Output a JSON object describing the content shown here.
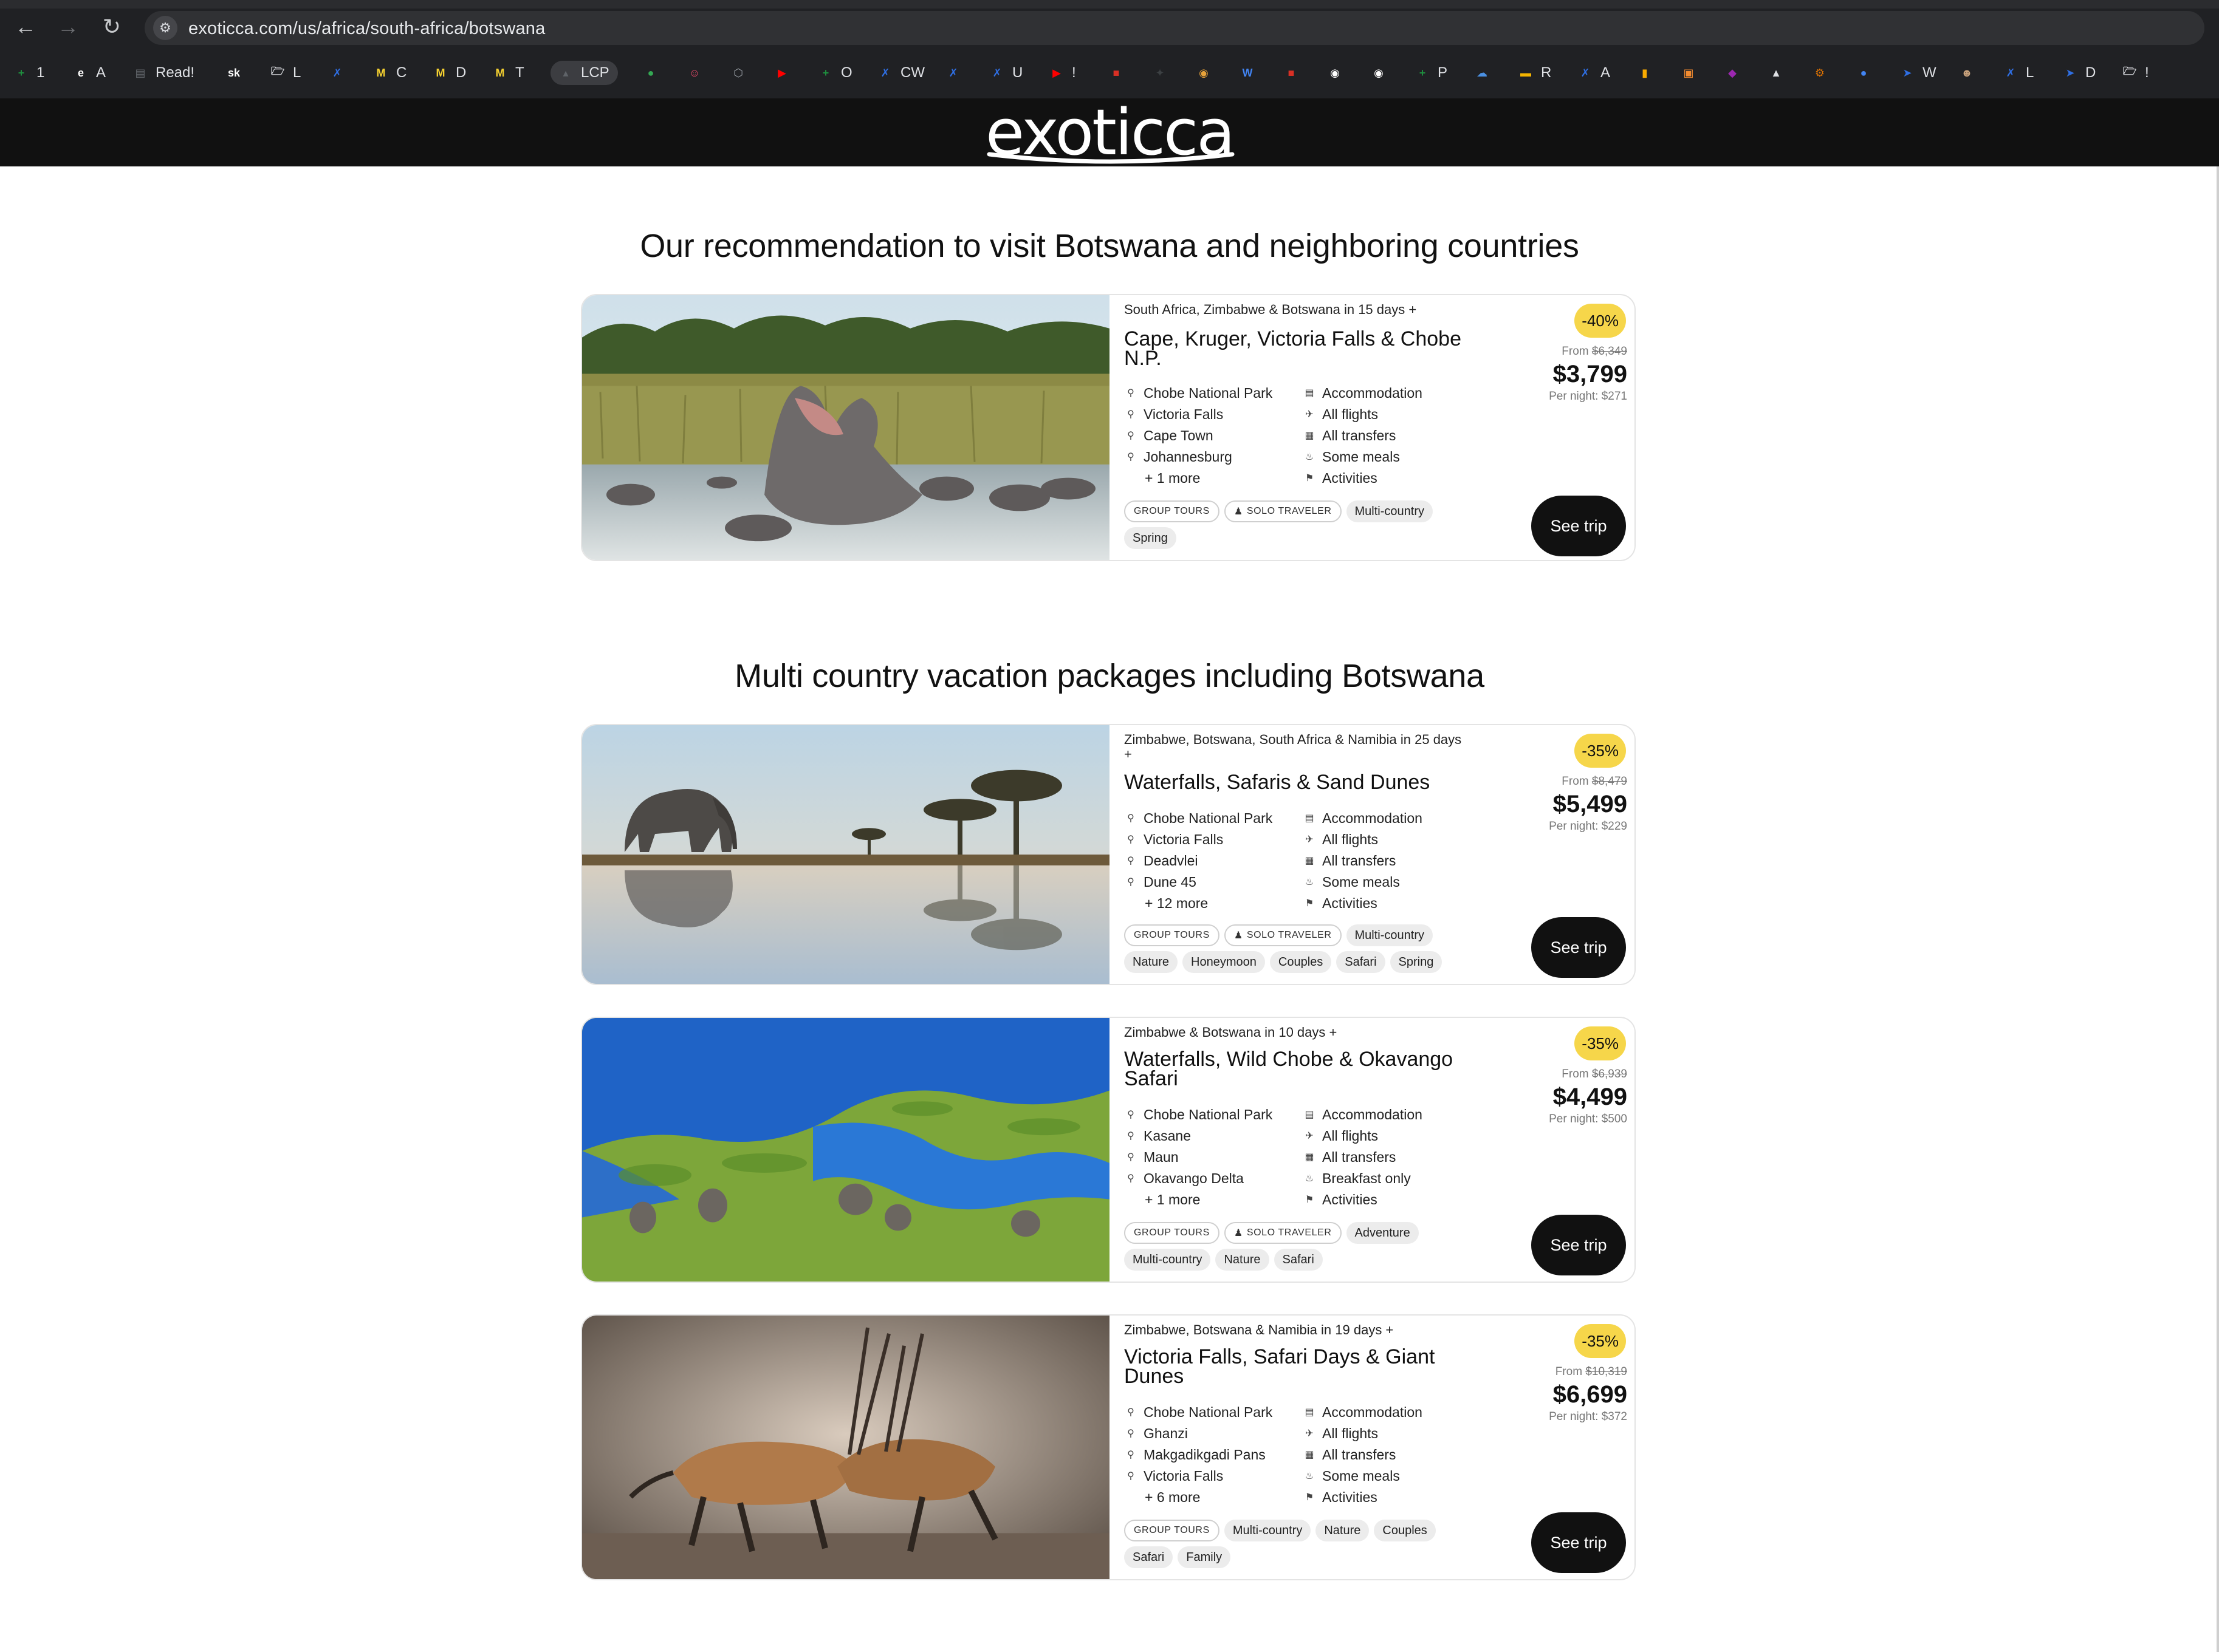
{
  "browser": {
    "url": "exoticca.com/us/africa/south-africa/botswana",
    "bookmarks": [
      {
        "label": "1",
        "icon": "sheets-icon",
        "color": "#1e8e3e"
      },
      {
        "label": "A",
        "icon": "exoticca-icon",
        "color": "#ffffff"
      },
      {
        "label": "Read!",
        "icon": "reader-icon",
        "color": "#5f6368"
      },
      {
        "label": "",
        "icon": "sk-icon",
        "color": "#ffffff"
      },
      {
        "label": "L",
        "icon": "folder-icon",
        "color": "#dfe1e5"
      },
      {
        "label": "",
        "icon": "confluence-icon",
        "color": "#2f6fe4"
      },
      {
        "label": "C",
        "icon": "miro-icon",
        "color": "#f5d130"
      },
      {
        "label": "D",
        "icon": "miro-icon",
        "color": "#f5d130"
      },
      {
        "label": "T",
        "icon": "miro-icon",
        "color": "#f5d130"
      },
      {
        "label": "LCP",
        "icon": "lcp-icon",
        "color": "#5f6368"
      },
      {
        "label": "",
        "icon": "leaf-icon",
        "color": "#34a853"
      },
      {
        "label": "",
        "icon": "face-icon",
        "color": "#ea4a6a"
      },
      {
        "label": "",
        "icon": "cube-icon",
        "color": "#9aa0a6"
      },
      {
        "label": "",
        "icon": "youtube-icon",
        "color": "#ff0000"
      },
      {
        "label": "O",
        "icon": "sheets-icon",
        "color": "#1e8e3e"
      },
      {
        "label": "CW",
        "icon": "confluence-icon",
        "color": "#2f6fe4"
      },
      {
        "label": "",
        "icon": "confluence-icon",
        "color": "#2f6fe4"
      },
      {
        "label": "U",
        "icon": "confluence-icon",
        "color": "#2f6fe4"
      },
      {
        "label": "!",
        "icon": "youtube-icon",
        "color": "#ff0000"
      },
      {
        "label": "",
        "icon": "lego-icon",
        "color": "#d93025"
      },
      {
        "label": "",
        "icon": "bird-icon",
        "color": "#3c4043"
      },
      {
        "label": "",
        "icon": "mask-icon",
        "color": "#e8a33a"
      },
      {
        "label": "",
        "icon": "w-icon",
        "color": "#4285f4"
      },
      {
        "label": "",
        "icon": "square-icon",
        "color": "#d93025"
      },
      {
        "label": "",
        "icon": "github-icon",
        "color": "#ffffff"
      },
      {
        "label": "",
        "icon": "github-icon",
        "color": "#ffffff"
      },
      {
        "label": "P",
        "icon": "sheets-icon",
        "color": "#1e8e3e"
      },
      {
        "label": "",
        "icon": "cloud-icon",
        "color": "#4a90e2"
      },
      {
        "label": "R",
        "icon": "slides-icon",
        "color": "#f4b400"
      },
      {
        "label": "A",
        "icon": "confluence-icon",
        "color": "#2f6fe4"
      },
      {
        "label": "",
        "icon": "bar-icon",
        "color": "#f9ab00"
      },
      {
        "label": "",
        "icon": "orange-icon",
        "color": "#f28b30"
      },
      {
        "label": "",
        "icon": "purple-icon",
        "color": "#9c27b0"
      },
      {
        "label": "",
        "icon": "triangle-icon",
        "color": "#dfe1e5"
      },
      {
        "label": "",
        "icon": "gear-icon",
        "color": "#e37400"
      },
      {
        "label": "",
        "icon": "drop-icon",
        "color": "#4285f4"
      },
      {
        "label": "W",
        "icon": "jira-icon",
        "color": "#2f6fe4"
      },
      {
        "label": "",
        "icon": "avatar-icon",
        "color": "#c9a27c"
      },
      {
        "label": "L",
        "icon": "confluence-icon",
        "color": "#2f6fe4"
      },
      {
        "label": "D",
        "icon": "jira-icon",
        "color": "#2f6fe4"
      },
      {
        "label": "!",
        "icon": "folder-icon",
        "color": "#dfe1e5"
      }
    ]
  },
  "site": {
    "logo": "exoticca"
  },
  "section1": {
    "title": "Our recommendation to visit Botswana and neighboring countries"
  },
  "section2": {
    "title": "Multi country vacation packages including Botswana"
  },
  "trips": [
    {
      "route": "South Africa, Zimbabwe & Botswana in 15 days +",
      "title": "Cape, Kruger, Victoria Falls & Chobe N.P.",
      "places": [
        "Chobe National Park",
        "Victoria Falls",
        "Cape Town",
        "Johannesburg"
      ],
      "more": "+ 1 more",
      "includes": [
        "Accommodation",
        "All flights",
        "All transfers",
        "Some meals",
        "Activities"
      ],
      "tags_outline": [
        "GROUP TOURS",
        "SOLO TRAVELER"
      ],
      "tags_fill": [
        "Multi-country",
        "Spring"
      ],
      "discount": "-40%",
      "from_label": "From",
      "old_price": "$6,349",
      "price": "$3,799",
      "per_night": "Per night: $271",
      "cta": "See trip"
    },
    {
      "route": "Zimbabwe, Botswana, South Africa & Namibia in 25 days +",
      "title": "Waterfalls, Safaris & Sand Dunes",
      "places": [
        "Chobe National Park",
        "Victoria Falls",
        "Deadvlei",
        "Dune 45"
      ],
      "more": "+ 12 more",
      "includes": [
        "Accommodation",
        "All flights",
        "All transfers",
        "Some meals",
        "Activities"
      ],
      "tags_outline": [
        "GROUP TOURS",
        "SOLO TRAVELER"
      ],
      "tags_fill": [
        "Multi-country",
        "Nature",
        "Honeymoon",
        "Couples",
        "Safari",
        "Spring"
      ],
      "discount": "-35%",
      "from_label": "From",
      "old_price": "$8,479",
      "price": "$5,499",
      "per_night": "Per night: $229",
      "cta": "See trip"
    },
    {
      "route": "Zimbabwe & Botswana in 10 days +",
      "title": "Waterfalls, Wild Chobe & Okavango Safari",
      "places": [
        "Chobe National Park",
        "Kasane",
        "Maun",
        "Okavango Delta"
      ],
      "more": "+ 1 more",
      "includes": [
        "Accommodation",
        "All flights",
        "All transfers",
        "Breakfast only",
        "Activities"
      ],
      "tags_outline": [
        "GROUP TOURS",
        "SOLO TRAVELER"
      ],
      "tags_fill": [
        "Adventure",
        "Multi-country",
        "Nature",
        "Safari"
      ],
      "discount": "-35%",
      "from_label": "From",
      "old_price": "$6,939",
      "price": "$4,499",
      "per_night": "Per night: $500",
      "cta": "See trip"
    },
    {
      "route": "Zimbabwe, Botswana & Namibia in 19 days +",
      "title": "Victoria Falls, Safari Days & Giant Dunes",
      "places": [
        "Chobe National Park",
        "Ghanzi",
        "Makgadikgadi Pans",
        "Victoria Falls"
      ],
      "more": "+ 6 more",
      "includes": [
        "Accommodation",
        "All flights",
        "All transfers",
        "Some meals",
        "Activities"
      ],
      "tags_outline": [
        "GROUP TOURS"
      ],
      "tags_fill": [
        "Multi-country",
        "Nature",
        "Couples",
        "Safari",
        "Family"
      ],
      "discount": "-35%",
      "from_label": "From",
      "old_price": "$10,319",
      "price": "$6,699",
      "per_night": "Per night: $372",
      "cta": "See trip"
    }
  ],
  "icons": {
    "place": "map-pin-icon",
    "include": [
      "bed-icon",
      "plane-icon",
      "bus-icon",
      "meal-icon",
      "activity-icon"
    ],
    "solo": "person-icon"
  }
}
